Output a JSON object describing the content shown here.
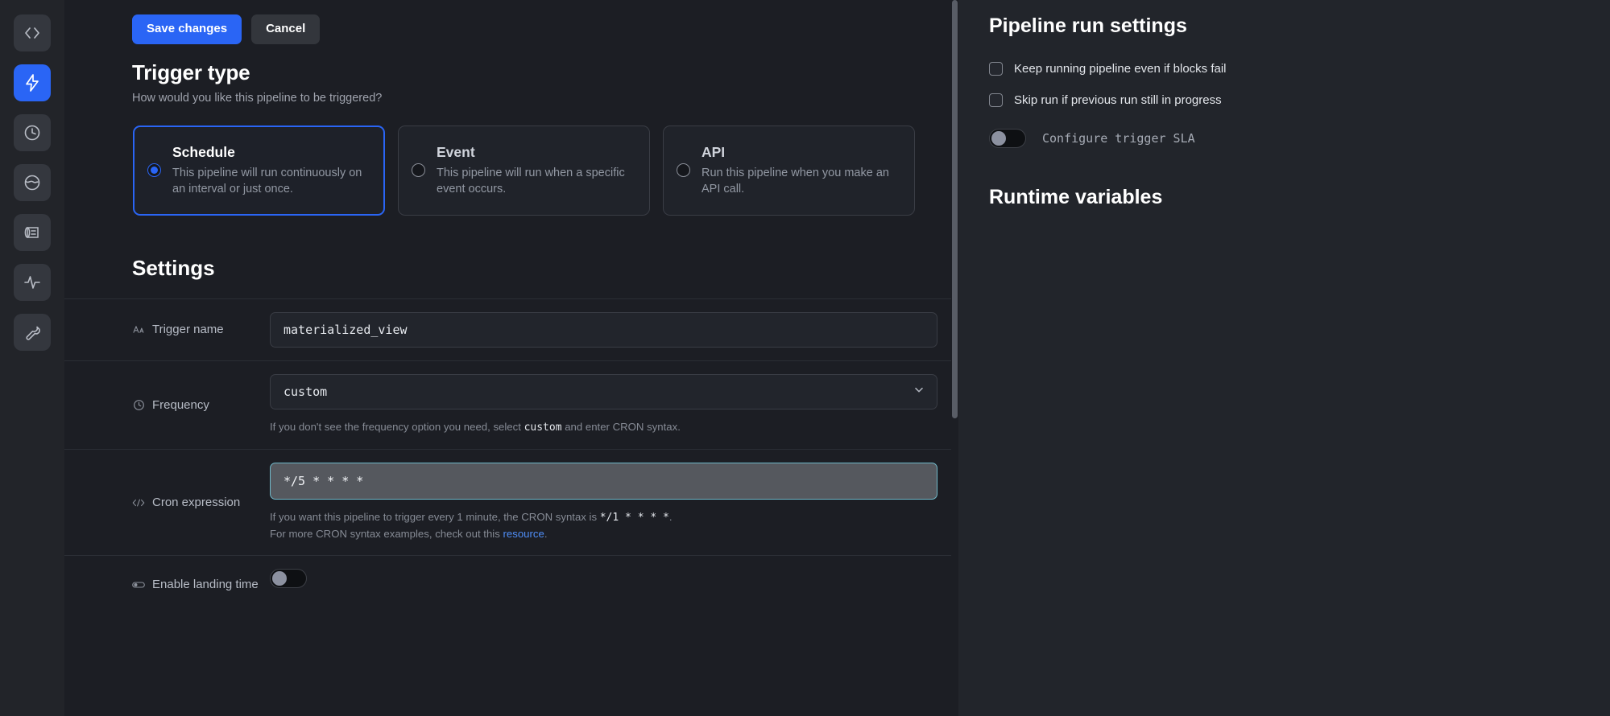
{
  "rail": {
    "items": [
      {
        "name": "code-icon",
        "active": false
      },
      {
        "name": "lightning-icon",
        "active": true
      },
      {
        "name": "clock-icon",
        "active": false
      },
      {
        "name": "globe-icon",
        "active": false
      },
      {
        "name": "logs-icon",
        "active": false
      },
      {
        "name": "pulse-icon",
        "active": false
      },
      {
        "name": "wrench-icon",
        "active": false
      }
    ]
  },
  "toolbar": {
    "save_label": "Save changes",
    "cancel_label": "Cancel"
  },
  "trigger_type": {
    "title": "Trigger type",
    "subtitle": "How would you like this pipeline to be triggered?",
    "options": [
      {
        "id": "schedule",
        "title": "Schedule",
        "description": "This pipeline will run continuously on an interval or just once.",
        "selected": true
      },
      {
        "id": "event",
        "title": "Event",
        "description": "This pipeline will run when a specific event occurs.",
        "selected": false
      },
      {
        "id": "api",
        "title": "API",
        "description": "Run this pipeline when you make an API call.",
        "selected": false
      }
    ]
  },
  "settings": {
    "title": "Settings",
    "trigger_name": {
      "label": "Trigger name",
      "icon": "text-format-icon",
      "value": "materialized_view"
    },
    "frequency": {
      "label": "Frequency",
      "icon": "clock-icon",
      "value": "custom",
      "hint_prefix": "If you don't see the frequency option you need, select ",
      "hint_code": "custom",
      "hint_suffix": " and enter CRON syntax."
    },
    "cron": {
      "label": "Cron expression",
      "icon": "code-icon",
      "value": "*/5 * * * *",
      "hint1_prefix": "If you want this pipeline to trigger every 1 minute, the CRON syntax is ",
      "hint1_code": "*/1 * * * *",
      "hint1_suffix": ".",
      "hint2_prefix": "For more CRON syntax examples, check out this ",
      "hint2_link": "resource",
      "hint2_suffix": "."
    },
    "landing_time": {
      "label": "Enable landing time",
      "icon": "toggle-icon",
      "enabled": false
    }
  },
  "right_panel": {
    "title": "Pipeline run settings",
    "checkboxes": [
      {
        "label": "Keep running pipeline even if blocks fail",
        "checked": false
      },
      {
        "label": "Skip run if previous run still in progress",
        "checked": false
      }
    ],
    "sla": {
      "label": "Configure trigger SLA",
      "enabled": false
    },
    "runtime_title": "Runtime variables"
  },
  "colors": {
    "accent": "#2a65f5",
    "panel_bg": "#22252b",
    "main_bg": "#1c1e24",
    "cron_border": "#6fb8c9",
    "link": "#4f8ef7"
  }
}
